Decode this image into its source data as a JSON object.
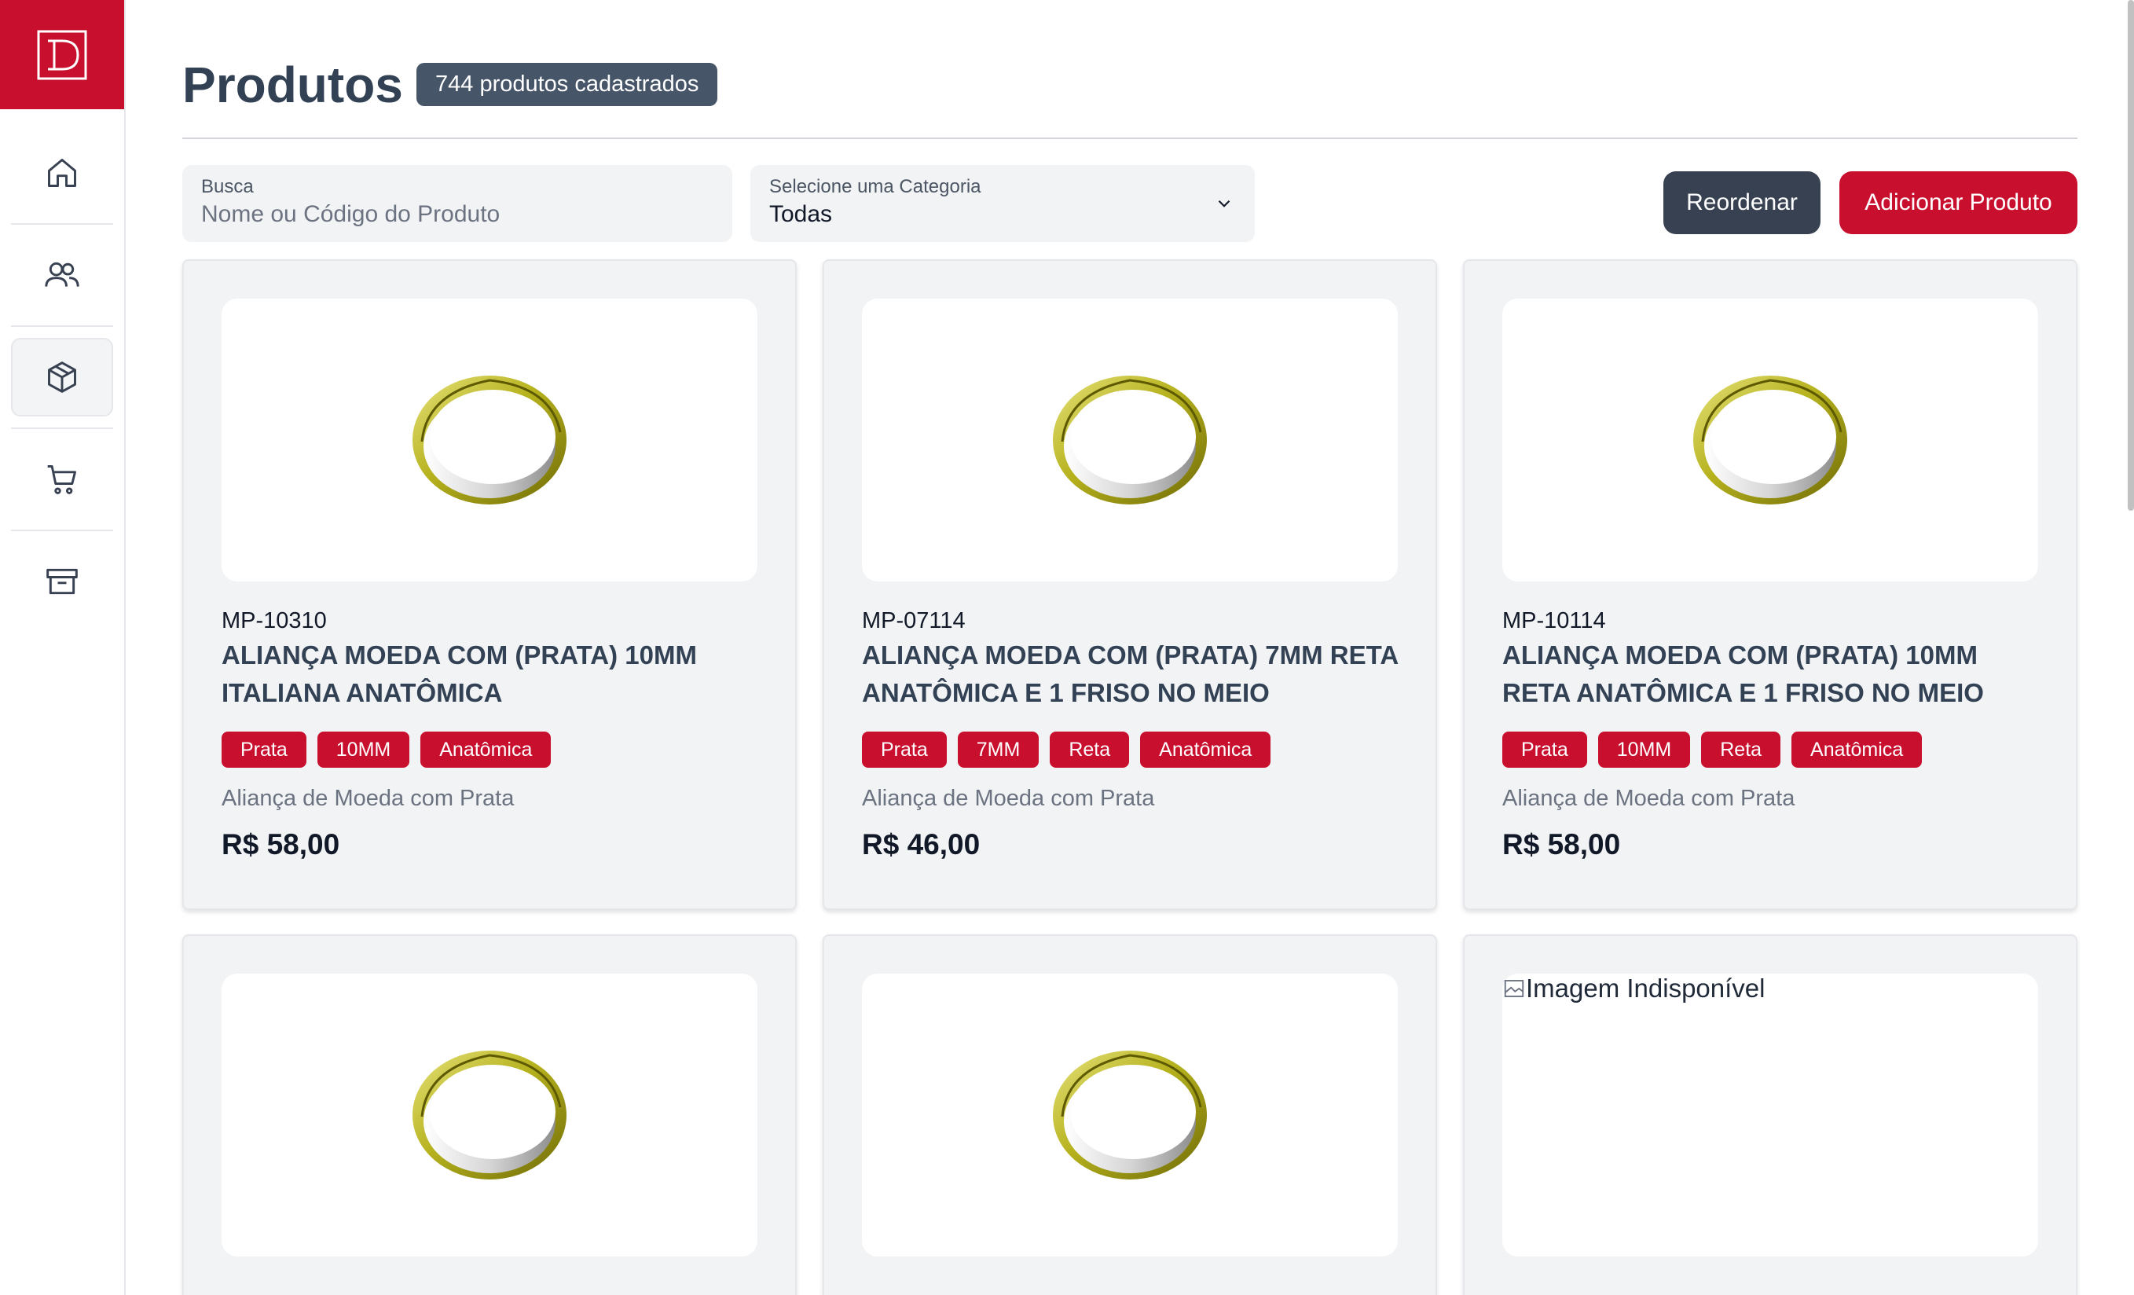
{
  "sidebar": {
    "items": [
      {
        "name": "home",
        "icon": "home-icon"
      },
      {
        "name": "users",
        "icon": "users-icon"
      },
      {
        "name": "products",
        "icon": "box-icon",
        "active": true
      },
      {
        "name": "cart",
        "icon": "cart-icon"
      },
      {
        "name": "archive",
        "icon": "archive-icon"
      }
    ]
  },
  "header": {
    "title": "Produtos",
    "badge": "744 produtos cadastrados"
  },
  "toolbar": {
    "search_label": "Busca",
    "search_placeholder": "Nome ou Código do Produto",
    "category_label": "Selecione uma Categoria",
    "category_value": "Todas",
    "reorder_label": "Reordenar",
    "add_label": "Adicionar Produto"
  },
  "products": [
    {
      "code": "MP-10310",
      "name": "ALIANÇA MOEDA COM (PRATA) 10MM ITALIANA ANATÔMICA",
      "tags": [
        "Prata",
        "10MM",
        "Anatômica"
      ],
      "description": "Aliança de Moeda com Prata",
      "price": "R$ 58,00"
    },
    {
      "code": "MP-07114",
      "name": "ALIANÇA MOEDA COM (PRATA) 7MM RETA ANATÔMICA E 1 FRISO NO MEIO",
      "tags": [
        "Prata",
        "7MM",
        "Reta",
        "Anatômica"
      ],
      "description": "Aliança de Moeda com Prata",
      "price": "R$ 46,00"
    },
    {
      "code": "MP-10114",
      "name": "ALIANÇA MOEDA COM (PRATA) 10MM RETA ANATÔMICA E 1 FRISO NO MEIO",
      "tags": [
        "Prata",
        "10MM",
        "Reta",
        "Anatômica"
      ],
      "description": "Aliança de Moeda com Prata",
      "price": "R$ 58,00"
    }
  ],
  "partial_cards": [
    {
      "alt": ""
    },
    {
      "alt": ""
    },
    {
      "alt": "Imagem Indisponível"
    }
  ],
  "colors": {
    "brand_red": "#c8102e",
    "slate": "#334155",
    "badge": "#475569",
    "card_bg": "#f1f3f5"
  }
}
